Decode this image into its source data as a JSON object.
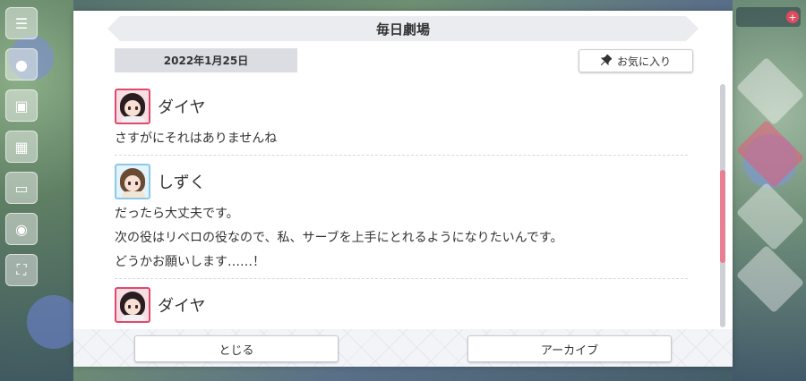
{
  "dialog": {
    "title": "毎日劇場",
    "date": "2022年1月25日",
    "favorite_label": "お気に入り",
    "close_label": "とじる",
    "archive_label": "アーカイブ"
  },
  "entries": [
    {
      "speaker": "ダイヤ",
      "avatar": "dia-avatar",
      "lines": [
        "さすがにそれはありませんね"
      ]
    },
    {
      "speaker": "しずく",
      "avatar": "shizuku-avatar",
      "lines": [
        "だったら大丈夫です。",
        "次の役はリベロの役なので、私、サーブを上手にとれるようになりたいんです。",
        "どうかお願いします……！"
      ]
    },
    {
      "speaker": "ダイヤ",
      "avatar": "dia-avatar",
      "lines": []
    }
  ],
  "icons": {
    "pin": "pushpin-icon",
    "menu": "hamburger-menu-icon"
  },
  "colors": {
    "accent_pink": "#e87f92",
    "avatar_border_red": "#e04a6a",
    "avatar_border_blue": "#8cc8e8",
    "title_band": "#ebecef"
  }
}
